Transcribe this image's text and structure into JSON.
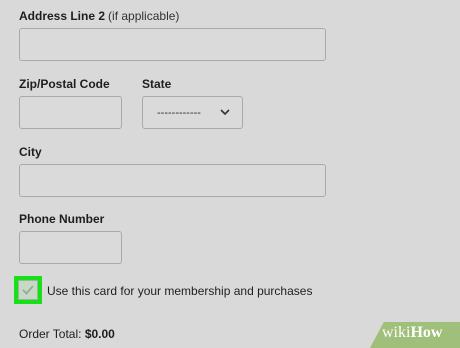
{
  "form": {
    "address2": {
      "label": "Address Line 2",
      "note": "(if applicable)",
      "value": ""
    },
    "zip": {
      "label": "Zip/Postal Code",
      "value": ""
    },
    "state": {
      "label": "State",
      "selected": "------------"
    },
    "city": {
      "label": "City",
      "value": ""
    },
    "phone": {
      "label": "Phone Number",
      "value": ""
    },
    "membership_checkbox": {
      "label": "Use this card for your membership and purchases",
      "checked": true,
      "highlight_color": "#18e018"
    },
    "order_total": {
      "label": "Order Total:",
      "value": "$0.00"
    }
  },
  "watermark": {
    "part1": "wiki",
    "part2": "How",
    "band_color": "#9fbf7a"
  },
  "icons": {
    "state_dropdown": "chevron-down-icon",
    "checkbox_mark": "checkmark-icon"
  }
}
